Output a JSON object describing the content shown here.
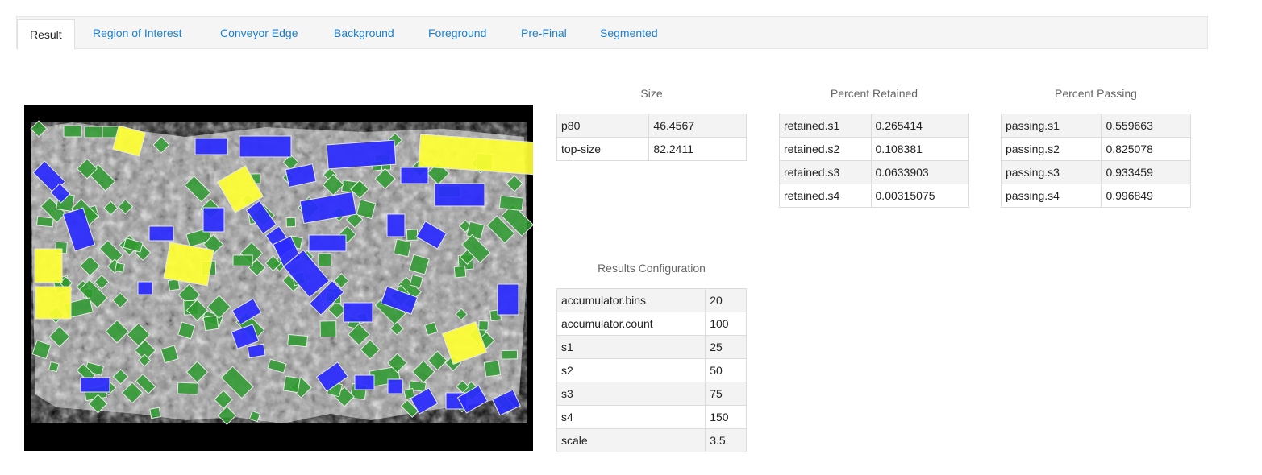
{
  "tabs": {
    "result": "Result",
    "roi": "Region of Interest",
    "conveyor_edge": "Conveyor Edge",
    "background": "Background",
    "foreground": "Foreground",
    "pre_final": "Pre-Final",
    "segmented": "Segmented"
  },
  "colors": {
    "link": "#1a7fd4",
    "large": "#ffff33",
    "medium": "#2a2aff",
    "small": "#2e9a2e"
  },
  "size_table": {
    "title": "Size",
    "rows": [
      {
        "key": "p80",
        "value": "46.4567"
      },
      {
        "key": "top-size",
        "value": "82.2411"
      }
    ]
  },
  "retained_table": {
    "title": "Percent Retained",
    "rows": [
      {
        "key": "retained.s1",
        "value": "0.265414"
      },
      {
        "key": "retained.s2",
        "value": "0.108381"
      },
      {
        "key": "retained.s3",
        "value": "0.0633903"
      },
      {
        "key": "retained.s4",
        "value": "0.00315075"
      }
    ]
  },
  "passing_table": {
    "title": "Percent Passing",
    "rows": [
      {
        "key": "passing.s1",
        "value": "0.559663"
      },
      {
        "key": "passing.s2",
        "value": "0.825078"
      },
      {
        "key": "passing.s3",
        "value": "0.933459"
      },
      {
        "key": "passing.s4",
        "value": "0.996849"
      }
    ]
  },
  "config_table": {
    "title": "Results Configuration",
    "rows": [
      {
        "key": "accumulator.bins",
        "value": "20"
      },
      {
        "key": "accumulator.count",
        "value": "100"
      },
      {
        "key": "s1",
        "value": "25"
      },
      {
        "key": "s2",
        "value": "50"
      },
      {
        "key": "s3",
        "value": "75"
      },
      {
        "key": "s4",
        "value": "150"
      },
      {
        "key": "scale",
        "value": "3.5"
      }
    ]
  }
}
